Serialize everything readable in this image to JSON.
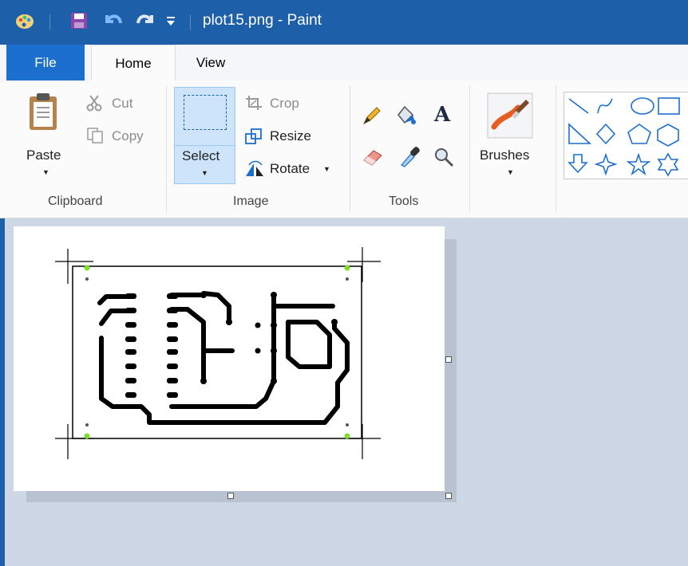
{
  "window": {
    "title": "plot15.png - Paint"
  },
  "tabs": {
    "file": "File",
    "home": "Home",
    "view": "View"
  },
  "clipboard": {
    "paste": "Paste",
    "cut": "Cut",
    "copy": "Copy",
    "group_label": "Clipboard"
  },
  "image": {
    "select": "Select",
    "crop": "Crop",
    "resize": "Resize",
    "rotate": "Rotate",
    "group_label": "Image"
  },
  "tools": {
    "group_label": "Tools",
    "items": [
      "pencil-icon",
      "fill-icon",
      "text-icon",
      "eraser-icon",
      "color-picker-icon",
      "magnifier-icon"
    ]
  },
  "brushes": {
    "label": "Brushes"
  },
  "shapes": {
    "items": [
      "line",
      "curve",
      "oval",
      "rectangle",
      "right-triangle",
      "diamond",
      "pentagon",
      "hexagon",
      "arrow-down",
      "four-point-star",
      "five-point-star",
      "six-point-star"
    ]
  },
  "colors": {
    "titlebar": "#1d5fa9",
    "file_tab": "#1d6fcd",
    "select_active": "#cde4fa",
    "workspace": "#cdd7e5"
  }
}
